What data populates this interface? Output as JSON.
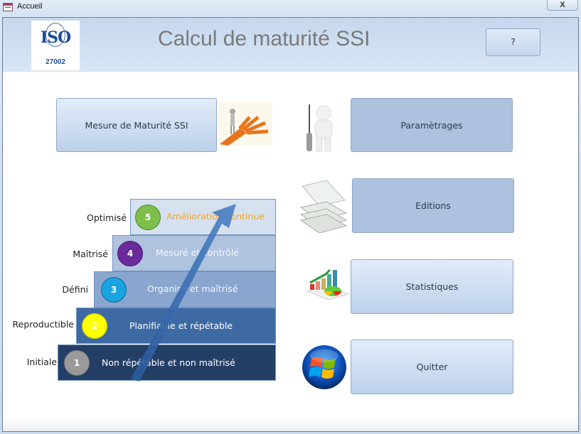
{
  "window": {
    "title": "Accueil",
    "close_label": "X"
  },
  "header": {
    "logo": {
      "name": "ISO",
      "number": "27002"
    },
    "title": "Calcul de maturité SSI",
    "help_label": "?"
  },
  "buttons": {
    "mesure": "Mesure de Maturité SSI",
    "parametrages": "Paramètrages",
    "editions": "Editions",
    "statistiques": "Statistiques",
    "quitter": "Quitter"
  },
  "icons": {
    "mesure": "person-crossroads-icon",
    "parametrages": "person-tool-icon",
    "editions": "paper-stack-icon",
    "statistiques": "charts-icon",
    "quitter": "windows-logo-icon"
  },
  "maturity_levels": [
    {
      "number": "1",
      "level": "Initiale",
      "description": "Non répétable et non maîtrisé",
      "circle_color": "#9a9a9a",
      "text_color": "#ffffff"
    },
    {
      "number": "2",
      "level": "Reproductible",
      "description": "Planifiable et répétable",
      "circle_color": "#ffff00",
      "text_color": "#ffffff"
    },
    {
      "number": "3",
      "level": "Défini",
      "description": "Organisé et maîtrisé",
      "circle_color": "#1aa3e0",
      "text_color": "#f0f4fa"
    },
    {
      "number": "4",
      "level": "Maîtrisé",
      "description": "Mesuré et contrôlé",
      "circle_color": "#6a2a9a",
      "text_color": "#f4f6fb"
    },
    {
      "number": "5",
      "level": "Optimisé",
      "description": "Amélioration continue",
      "circle_color": "#7dbf4a",
      "text_color": "#f5a623"
    }
  ]
}
